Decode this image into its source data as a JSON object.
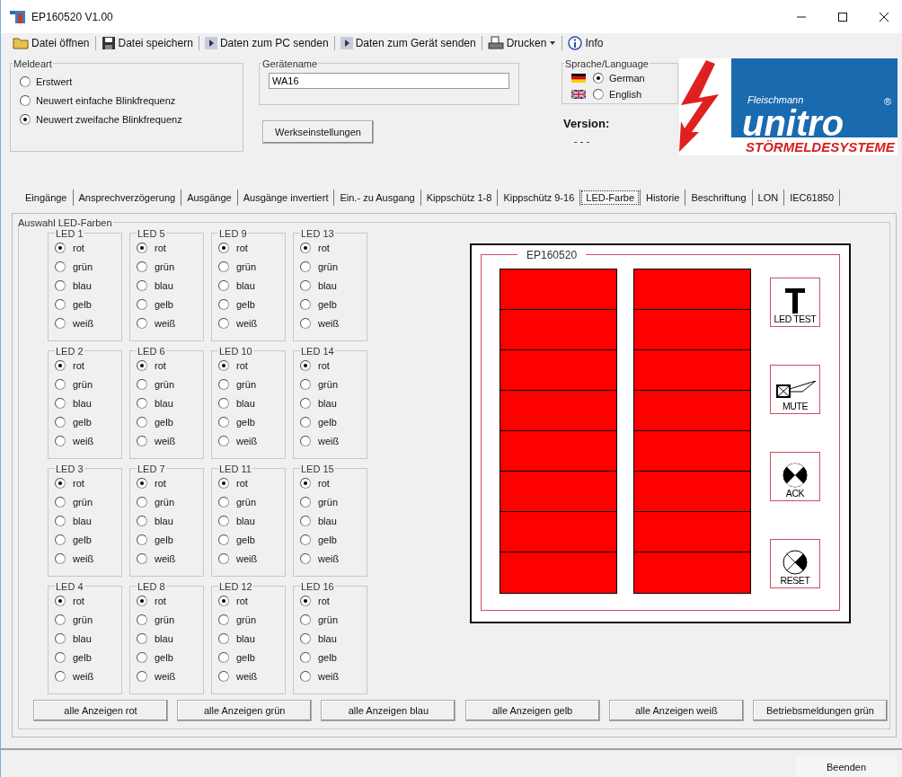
{
  "window": {
    "title": "EP160520 V1.00"
  },
  "toolbar": [
    {
      "label": "Datei öffnen",
      "dropdown": false
    },
    {
      "label": "Datei speichern",
      "dropdown": false
    },
    {
      "label": "Daten zum PC senden",
      "dropdown": false
    },
    {
      "label": "Daten zum Gerät senden",
      "dropdown": false
    },
    {
      "label": "Drucken",
      "dropdown": true
    },
    {
      "label": "Info",
      "dropdown": false
    }
  ],
  "meldeart": {
    "title": "Meldeart",
    "options": [
      {
        "label": "Erstwert",
        "selected": false
      },
      {
        "label": "Neuwert einfache Blinkfrequenz",
        "selected": false
      },
      {
        "label": "Neuwert zweifache Blinkfrequenz",
        "selected": true
      }
    ]
  },
  "geraetename": {
    "title": "Gerätename",
    "value": "WA16"
  },
  "factory_button": "Werkseinstellungen",
  "language": {
    "title": "Sprache/Language",
    "options": [
      {
        "label": "German",
        "selected": true
      },
      {
        "label": "English",
        "selected": false
      }
    ]
  },
  "version": {
    "label": "Version:",
    "value": "- - -"
  },
  "logo": {
    "small": "Fleischmann",
    "brand": "unitro",
    "registered": "®",
    "tagline": "STÖRMELDESYSTEME"
  },
  "tabs": [
    {
      "label": "Eingänge",
      "selected": false
    },
    {
      "label": "Ansprechverzögerung",
      "selected": false
    },
    {
      "label": "Ausgänge",
      "selected": false
    },
    {
      "label": "Ausgänge invertiert",
      "selected": false
    },
    {
      "label": "Ein.- zu Ausgang",
      "selected": false
    },
    {
      "label": "Kippschütz 1-8",
      "selected": false
    },
    {
      "label": "Kippschütz 9-16",
      "selected": false
    },
    {
      "label": "LED-Farbe",
      "selected": true
    },
    {
      "label": "Historie",
      "selected": false
    },
    {
      "label": "Beschriftung",
      "selected": false
    },
    {
      "label": "LON",
      "selected": false
    },
    {
      "label": "IEC61850",
      "selected": false
    }
  ],
  "led_colors": {
    "title": "Auswahl LED-Farben",
    "leds": [
      {
        "label": "LED 1",
        "options": [
          {
            "label": "rot",
            "selected": true
          },
          {
            "label": "grün",
            "selected": false
          },
          {
            "label": "blau",
            "selected": false
          },
          {
            "label": "gelb",
            "selected": false
          },
          {
            "label": "weiß",
            "selected": false
          }
        ]
      },
      {
        "label": "LED 2",
        "options": [
          {
            "label": "rot",
            "selected": true
          },
          {
            "label": "grün",
            "selected": false
          },
          {
            "label": "blau",
            "selected": false
          },
          {
            "label": "gelb",
            "selected": false
          },
          {
            "label": "weiß",
            "selected": false
          }
        ]
      },
      {
        "label": "LED 3",
        "options": [
          {
            "label": "rot",
            "selected": true
          },
          {
            "label": "grün",
            "selected": false
          },
          {
            "label": "blau",
            "selected": false
          },
          {
            "label": "gelb",
            "selected": false
          },
          {
            "label": "weiß",
            "selected": false
          }
        ]
      },
      {
        "label": "LED 4",
        "options": [
          {
            "label": "rot",
            "selected": true
          },
          {
            "label": "grün",
            "selected": false
          },
          {
            "label": "blau",
            "selected": false
          },
          {
            "label": "gelb",
            "selected": false
          },
          {
            "label": "weiß",
            "selected": false
          }
        ]
      },
      {
        "label": "LED 5",
        "options": [
          {
            "label": "rot",
            "selected": true
          },
          {
            "label": "grün",
            "selected": false
          },
          {
            "label": "blau",
            "selected": false
          },
          {
            "label": "gelb",
            "selected": false
          },
          {
            "label": "weiß",
            "selected": false
          }
        ]
      },
      {
        "label": "LED 6",
        "options": [
          {
            "label": "rot",
            "selected": true
          },
          {
            "label": "grün",
            "selected": false
          },
          {
            "label": "blau",
            "selected": false
          },
          {
            "label": "gelb",
            "selected": false
          },
          {
            "label": "weiß",
            "selected": false
          }
        ]
      },
      {
        "label": "LED 7",
        "options": [
          {
            "label": "rot",
            "selected": true
          },
          {
            "label": "grün",
            "selected": false
          },
          {
            "label": "blau",
            "selected": false
          },
          {
            "label": "gelb",
            "selected": false
          },
          {
            "label": "weiß",
            "selected": false
          }
        ]
      },
      {
        "label": "LED 8",
        "options": [
          {
            "label": "rot",
            "selected": true
          },
          {
            "label": "grün",
            "selected": false
          },
          {
            "label": "blau",
            "selected": false
          },
          {
            "label": "gelb",
            "selected": false
          },
          {
            "label": "weiß",
            "selected": false
          }
        ]
      },
      {
        "label": "LED 9",
        "options": [
          {
            "label": "rot",
            "selected": true
          },
          {
            "label": "grün",
            "selected": false
          },
          {
            "label": "blau",
            "selected": false
          },
          {
            "label": "gelb",
            "selected": false
          },
          {
            "label": "weiß",
            "selected": false
          }
        ]
      },
      {
        "label": "LED 10",
        "options": [
          {
            "label": "rot",
            "selected": true
          },
          {
            "label": "grün",
            "selected": false
          },
          {
            "label": "blau",
            "selected": false
          },
          {
            "label": "gelb",
            "selected": false
          },
          {
            "label": "weiß",
            "selected": false
          }
        ]
      },
      {
        "label": "LED 11",
        "options": [
          {
            "label": "rot",
            "selected": true
          },
          {
            "label": "grün",
            "selected": false
          },
          {
            "label": "blau",
            "selected": false
          },
          {
            "label": "gelb",
            "selected": false
          },
          {
            "label": "weiß",
            "selected": false
          }
        ]
      },
      {
        "label": "LED 12",
        "options": [
          {
            "label": "rot",
            "selected": true
          },
          {
            "label": "grün",
            "selected": false
          },
          {
            "label": "blau",
            "selected": false
          },
          {
            "label": "gelb",
            "selected": false
          },
          {
            "label": "weiß",
            "selected": false
          }
        ]
      },
      {
        "label": "LED 13",
        "options": [
          {
            "label": "rot",
            "selected": true
          },
          {
            "label": "grün",
            "selected": false
          },
          {
            "label": "blau",
            "selected": false
          },
          {
            "label": "gelb",
            "selected": false
          },
          {
            "label": "weiß",
            "selected": false
          }
        ]
      },
      {
        "label": "LED 14",
        "options": [
          {
            "label": "rot",
            "selected": true
          },
          {
            "label": "grün",
            "selected": false
          },
          {
            "label": "blau",
            "selected": false
          },
          {
            "label": "gelb",
            "selected": false
          },
          {
            "label": "weiß",
            "selected": false
          }
        ]
      },
      {
        "label": "LED 15",
        "options": [
          {
            "label": "rot",
            "selected": true
          },
          {
            "label": "grün",
            "selected": false
          },
          {
            "label": "blau",
            "selected": false
          },
          {
            "label": "gelb",
            "selected": false
          },
          {
            "label": "weiß",
            "selected": false
          }
        ]
      },
      {
        "label": "LED 16",
        "options": [
          {
            "label": "rot",
            "selected": true
          },
          {
            "label": "grün",
            "selected": false
          },
          {
            "label": "blau",
            "selected": false
          },
          {
            "label": "gelb",
            "selected": false
          },
          {
            "label": "weiß",
            "selected": false
          }
        ]
      }
    ]
  },
  "panel": {
    "title": "EP160520",
    "buttons": [
      {
        "label": "LED TEST",
        "kind": "test"
      },
      {
        "label": "MUTE",
        "kind": "mute"
      },
      {
        "label": "ACK",
        "kind": "ack"
      },
      {
        "label": "RESET",
        "kind": "reset"
      }
    ]
  },
  "bulk_buttons": [
    "alle Anzeigen rot",
    "alle Anzeigen grün",
    "alle Anzeigen blau",
    "alle Anzeigen gelb",
    "alle Anzeigen weiß",
    "Betriebsmeldungen grün"
  ],
  "footer_button": "Beenden"
}
